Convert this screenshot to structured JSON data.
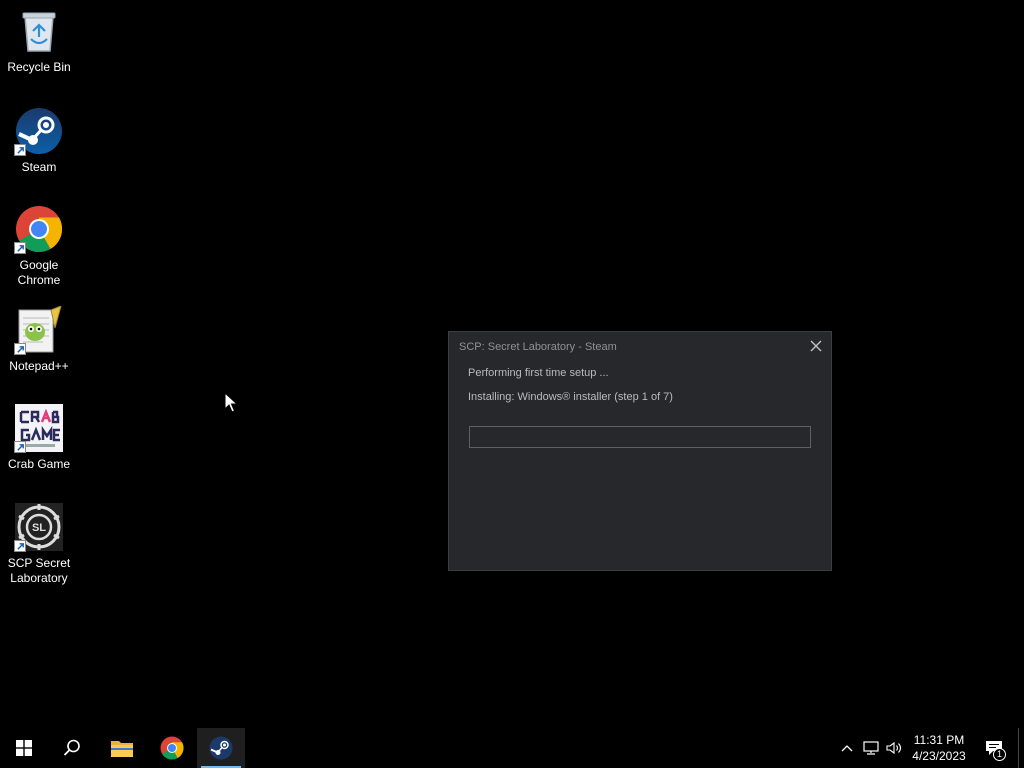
{
  "desktop": {
    "icons": [
      {
        "label": "Recycle Bin",
        "icon": "recycle-bin-icon"
      },
      {
        "label": "Steam",
        "icon": "steam-icon"
      },
      {
        "label": "Google\nChrome",
        "icon": "chrome-icon"
      },
      {
        "label": "Notepad++",
        "icon": "notepadpp-icon"
      },
      {
        "label": "Crab Game",
        "icon": "crab-game-icon"
      },
      {
        "label": "SCP Secret\nLaboratory",
        "icon": "scp-icon"
      }
    ]
  },
  "dialog": {
    "title": "SCP: Secret Laboratory - Steam",
    "status": "Performing first time setup ...",
    "step": "Installing: Windows® installer (step 1 of 7)",
    "progress": 0
  },
  "taskbar": {
    "time": "11:31 PM",
    "date": "4/23/2023",
    "notification_count": "1"
  },
  "colors": {
    "dialog_bg": "#26282b",
    "accent": "#76b9ed"
  }
}
